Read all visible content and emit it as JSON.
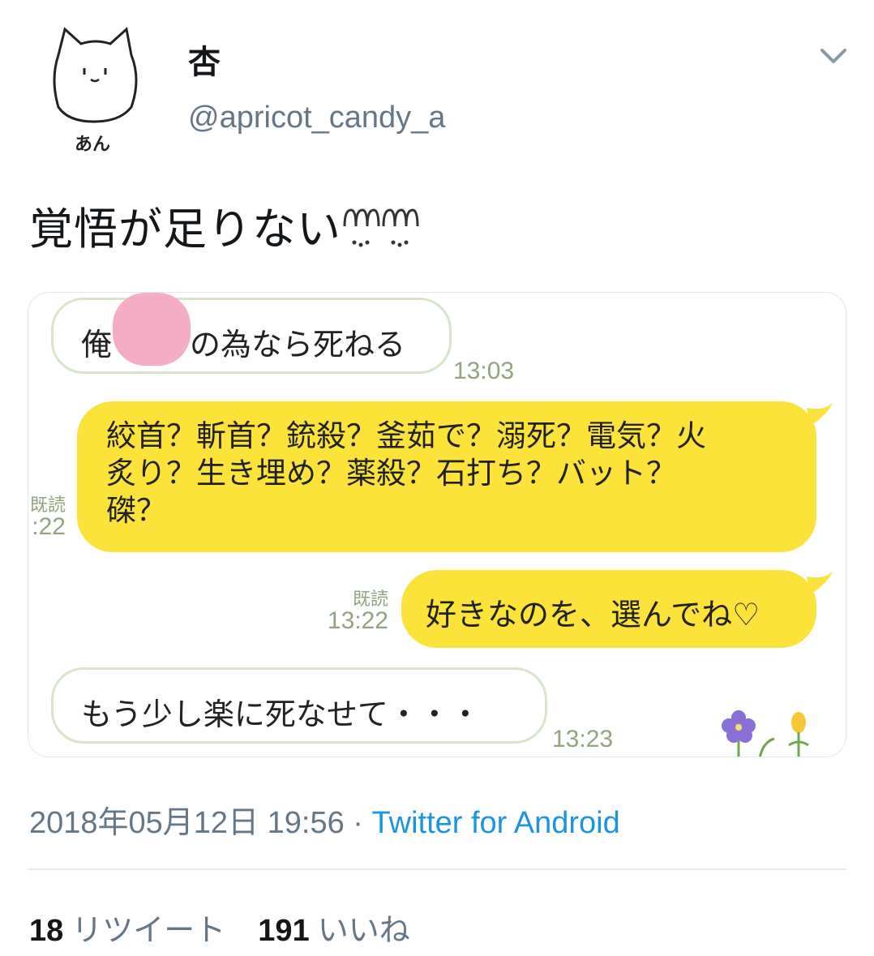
{
  "tweet": {
    "display_name": "杏",
    "handle": "@apricot_candy_a",
    "avatar_caption": "あん",
    "text": "覚悟が足りない",
    "date": "2018年05月12日 19:56",
    "separator": " · ",
    "source": "Twitter for Android",
    "retweet_count": "18",
    "retweet_label": "リツイート",
    "like_count": "191",
    "like_label": "いいね"
  },
  "chat": {
    "messages": [
      {
        "side": "left",
        "text_a": "俺",
        "text_b": "の為なら死ねる",
        "time": "13:03"
      },
      {
        "side": "right",
        "lines": [
          "絞首？斬首？銃殺？釜茹で？溺死？電気？火",
          "炙り？生き埋め？薬殺？石打ち？バット？",
          "磔？"
        ],
        "read_label": "既読",
        "time": ":22"
      },
      {
        "side": "right",
        "text": "好きなのを、選んでね♡",
        "read_label": "既読",
        "time": "13:22"
      },
      {
        "side": "left",
        "text": "もう少し楽に死なせて・・・",
        "time": "13:23"
      }
    ]
  },
  "colors": {
    "bubble_right": "#fbe33a",
    "bubble_left_border": "#d7e5c8",
    "time_text": "#92a47e",
    "link": "#1b95e0",
    "muted": "#657786"
  },
  "icons": {
    "menu": "chevron-down-icon",
    "emoji": "weary-face-emoji"
  }
}
